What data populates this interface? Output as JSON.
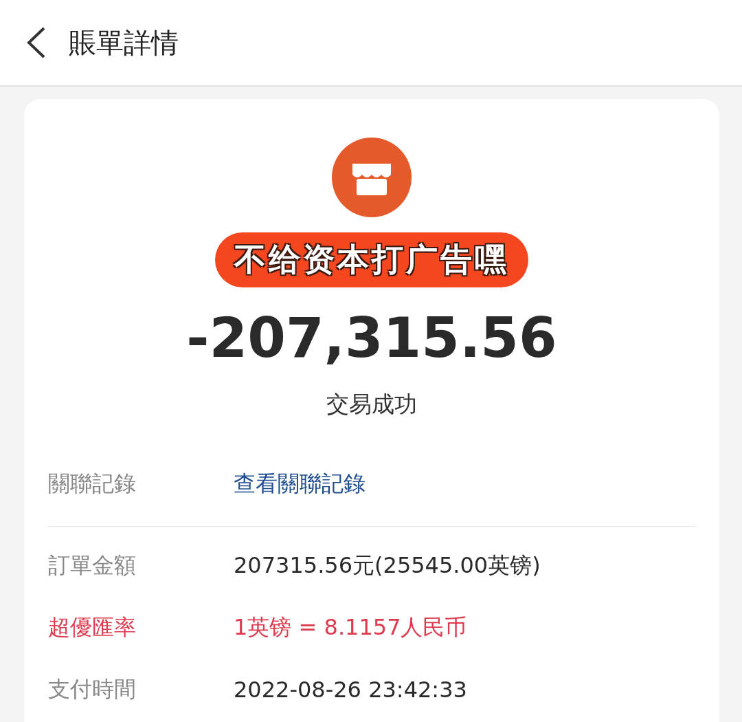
{
  "header": {
    "title": "賬單詳情"
  },
  "sticker": {
    "text": "不给资本打广告嘿"
  },
  "amount": "-207,315.56",
  "status": "交易成功",
  "sections": [
    {
      "rows": [
        {
          "kind": "link",
          "label": "關聯記錄",
          "value": "查看關聯記錄"
        }
      ]
    },
    {
      "rows": [
        {
          "kind": "normal",
          "label": "訂單金額",
          "value": "207315.56元(25545.00英镑)"
        },
        {
          "kind": "highlight",
          "label": "超優匯率",
          "value": "1英镑 = 8.1157人民币"
        },
        {
          "kind": "normal",
          "label": "支付時間",
          "value": "2022-08-26 23:42:33"
        }
      ]
    }
  ]
}
